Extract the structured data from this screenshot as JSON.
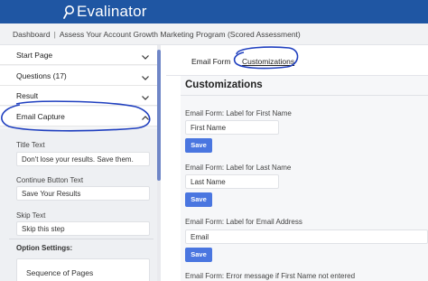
{
  "app": {
    "logo_text": "Evalinator"
  },
  "breadcrumb": {
    "home": "Dashboard",
    "separator": "|",
    "current": "Assess Your Account Growth Marketing Program (Scored Assessment)"
  },
  "sidebar": {
    "items": [
      {
        "label": "Start Page",
        "icon": "chevron-down-icon"
      },
      {
        "label": "Questions (17)",
        "icon": "chevron-down-icon"
      },
      {
        "label": "Result",
        "icon": "chevron-down-icon"
      },
      {
        "label": "Email Capture",
        "icon": "chevron-up-icon",
        "expanded": true
      }
    ],
    "email_capture": {
      "title_text_label": "Title Text",
      "title_text_value": "Don't lose your results. Save them.",
      "continue_button_label": "Continue Button Text",
      "continue_button_value": "Save Your Results",
      "skip_text_label": "Skip Text",
      "skip_text_value": "Skip this step",
      "option_settings_label": "Option Settings:",
      "sequence_label": "Sequence of Pages"
    }
  },
  "tabs": [
    {
      "label": "Email Form",
      "active": false
    },
    {
      "label": "Customizations",
      "active": true
    }
  ],
  "customizations": {
    "title": "Customizations",
    "fields": [
      {
        "label": "Email Form: Label for First Name",
        "value": "First Name",
        "save": "Save"
      },
      {
        "label": "Email Form: Label for Last Name",
        "value": "Last Name",
        "save": "Save"
      },
      {
        "label": "Email Form: Label for Email Address",
        "value": "Email",
        "save": "Save"
      }
    ],
    "error_label": "Email Form: Error message if First Name not entered"
  },
  "colors": {
    "topbar": "#1f56a3",
    "accent_button": "#4a76e0",
    "annotation": "#1f3fbf"
  }
}
